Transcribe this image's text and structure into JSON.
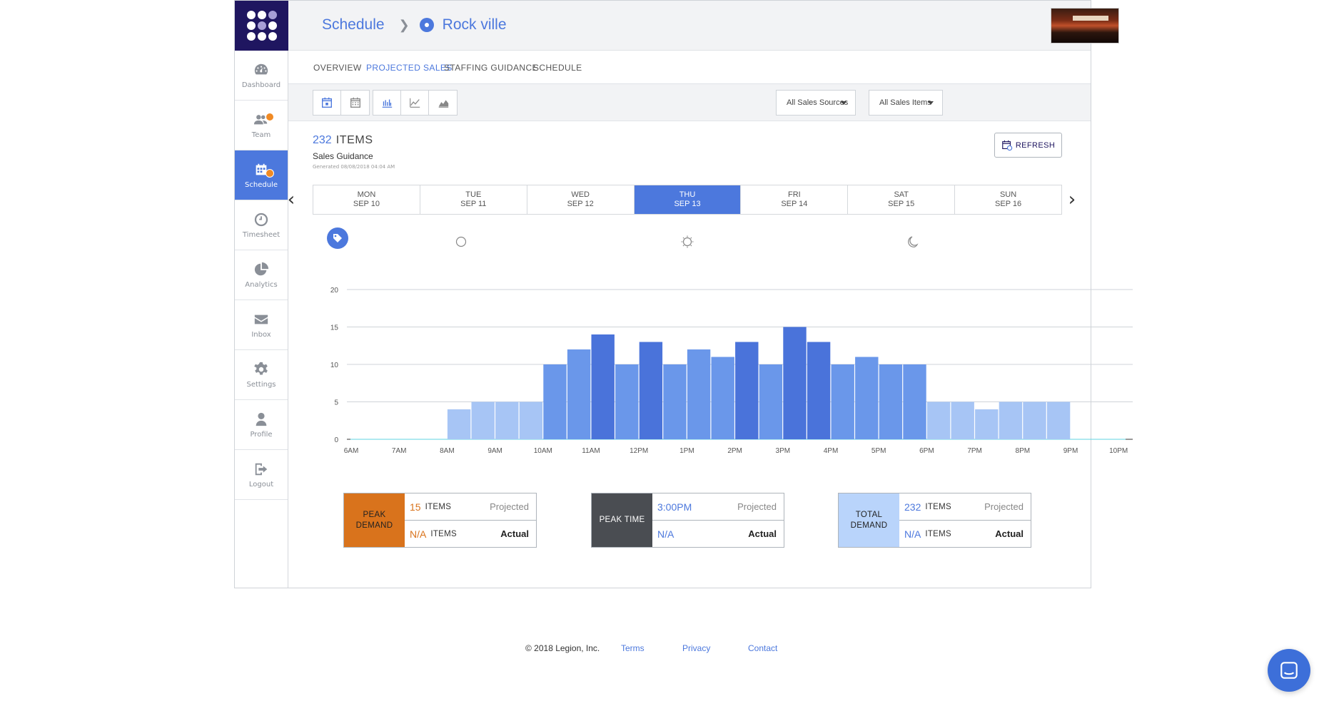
{
  "sidebar": {
    "items": [
      {
        "label": "Dashboard",
        "icon": "dashboard-icon"
      },
      {
        "label": "Team",
        "icon": "team-icon"
      },
      {
        "label": "Schedule",
        "icon": "calendar-icon"
      },
      {
        "label": "Timesheet",
        "icon": "clock-icon"
      },
      {
        "label": "Analytics",
        "icon": "pie-chart-icon"
      },
      {
        "label": "Inbox",
        "icon": "envelope-icon"
      },
      {
        "label": "Settings",
        "icon": "gear-icon"
      },
      {
        "label": "Profile",
        "icon": "person-icon"
      },
      {
        "label": "Logout",
        "icon": "logout-icon"
      }
    ],
    "active": "Schedule"
  },
  "breadcrumb": {
    "section": "Schedule",
    "location": "Rock ville"
  },
  "tabs": [
    "OVERVIEW",
    "PROJECTED SALES",
    "STAFFING GUIDANCE",
    "SCHEDULE"
  ],
  "active_tab": "PROJECTED SALES",
  "filters": {
    "sales_sources": "All Sales Sources",
    "sales_items": "All Sales Items"
  },
  "summary": {
    "count": "232",
    "count_label": "ITEMS",
    "subtitle": "Sales Guidance",
    "generated": "Generated 08/08/2018 04:04 AM",
    "refresh_label": "REFRESH"
  },
  "days": [
    {
      "dow": "MON",
      "date": "SEP 10"
    },
    {
      "dow": "TUE",
      "date": "SEP 11"
    },
    {
      "dow": "WED",
      "date": "SEP 12"
    },
    {
      "dow": "THU",
      "date": "SEP 13"
    },
    {
      "dow": "FRI",
      "date": "SEP 14"
    },
    {
      "dow": "SAT",
      "date": "SEP 15"
    },
    {
      "dow": "SUN",
      "date": "SEP 16"
    }
  ],
  "active_day": "THU",
  "chart_data": {
    "type": "bar",
    "title": "",
    "xlabel": "",
    "ylabel": "",
    "ylim": [
      0,
      20
    ],
    "yticks": [
      0,
      5,
      10,
      15,
      20
    ],
    "xticks": [
      "6AM",
      "7AM",
      "8AM",
      "9AM",
      "10AM",
      "11AM",
      "12PM",
      "1PM",
      "2PM",
      "3PM",
      "4PM",
      "5PM",
      "6PM",
      "7PM",
      "8PM",
      "9PM",
      "10PM"
    ],
    "interval": "30min",
    "start": "6AM",
    "values": [
      0,
      0,
      0,
      0,
      4,
      5,
      5,
      5,
      10,
      12,
      14,
      10,
      13,
      10,
      12,
      11,
      13,
      10,
      15,
      13,
      10,
      11,
      10,
      10,
      5,
      5,
      4,
      5,
      5,
      5,
      0,
      0,
      0,
      0
    ],
    "colors": {
      "low": "#a7c5f5",
      "mid": "#6a97ea",
      "high": "#4a73da"
    }
  },
  "cards": [
    {
      "title_lines": [
        "PEAK",
        "DEMAND"
      ],
      "projected_value": "15",
      "projected_unit": "ITEMS",
      "projected_tag": "Projected",
      "actual_value": "N/A",
      "actual_unit": "ITEMS",
      "actual_tag": "Actual",
      "head_color": "#d9731c",
      "value_color": "#d9731c"
    },
    {
      "title_lines": [
        "PEAK TIME"
      ],
      "projected_value": "3:00PM",
      "projected_unit": "",
      "projected_tag": "Projected",
      "actual_value": "N/A",
      "actual_unit": "",
      "actual_tag": "Actual",
      "head_color": "#4a4d52",
      "value_color": "#4c78dd"
    },
    {
      "title_lines": [
        "TOTAL",
        "DEMAND"
      ],
      "projected_value": "232",
      "projected_unit": "ITEMS",
      "projected_tag": "Projected",
      "actual_value": "N/A",
      "actual_unit": "ITEMS",
      "actual_tag": "Actual",
      "head_color": "#b9d4fb",
      "value_color": "#4c78dd"
    }
  ],
  "footer": {
    "copyright": "© 2018 Legion, Inc.",
    "links": [
      "Terms",
      "Privacy",
      "Contact"
    ]
  },
  "colors": {
    "accent": "#4c78dd",
    "logo_bg": "#1f1660",
    "warning": "#f08a24"
  }
}
